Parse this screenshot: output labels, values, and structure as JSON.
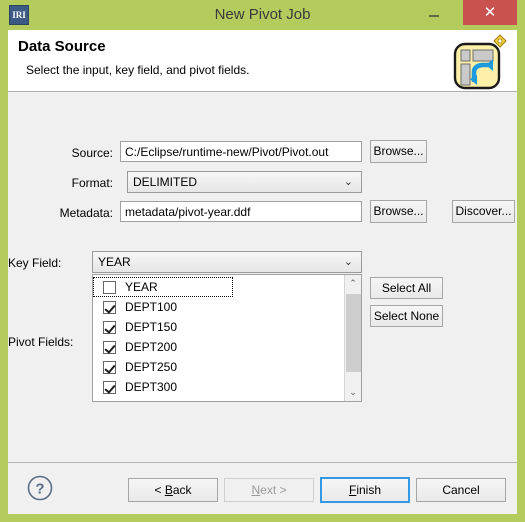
{
  "window": {
    "title": "New Pivot Job",
    "app_icon_label": "IRI",
    "accent_green": "#b4cb5e",
    "close_red": "#c9524f",
    "controls": {
      "minimize": "minimize-button",
      "maximize": "maximize-button",
      "close_glyph": "✕"
    }
  },
  "header": {
    "title": "Data Source",
    "description": "Select the input, key field, and pivot fields.",
    "icon_name": "pivot-table-icon"
  },
  "form": {
    "source": {
      "label": "Source:",
      "value": "C:/Eclipse/runtime-new/Pivot/Pivot.out",
      "placeholder": "",
      "browse_label": "Browse..."
    },
    "format": {
      "label": "Format:",
      "value": "DELIMITED",
      "chevron": "⌄"
    },
    "metadata": {
      "label": "Metadata:",
      "value": "metadata/pivot-year.ddf",
      "placeholder": "",
      "browse_label": "Browse...",
      "discover_label": "Discover..."
    },
    "key_field": {
      "label": "Key Field:",
      "value": "YEAR",
      "chevron": "⌄"
    },
    "pivot_fields": {
      "label": "Pivot Fields:",
      "select_all_label": "Select All",
      "select_none_label": "Select None",
      "items": [
        {
          "label": "YEAR",
          "checked": false,
          "focused": true
        },
        {
          "label": "DEPT100",
          "checked": true,
          "focused": false
        },
        {
          "label": "DEPT150",
          "checked": true,
          "focused": false
        },
        {
          "label": "DEPT200",
          "checked": true,
          "focused": false
        },
        {
          "label": "DEPT250",
          "checked": true,
          "focused": false
        },
        {
          "label": "DEPT300",
          "checked": true,
          "focused": false
        }
      ],
      "scroll_up_glyph": "⌃",
      "scroll_down_glyph": "⌄"
    }
  },
  "footer": {
    "help_icon": "help-icon",
    "back": {
      "prefix": "< ",
      "mnemonic": "B",
      "suffix": "ack"
    },
    "next": {
      "prefix": "",
      "mnemonic": "N",
      "suffix": "ext >"
    },
    "finish": {
      "prefix": "",
      "mnemonic": "F",
      "suffix": "inish"
    },
    "cancel": {
      "label": "Cancel"
    }
  }
}
